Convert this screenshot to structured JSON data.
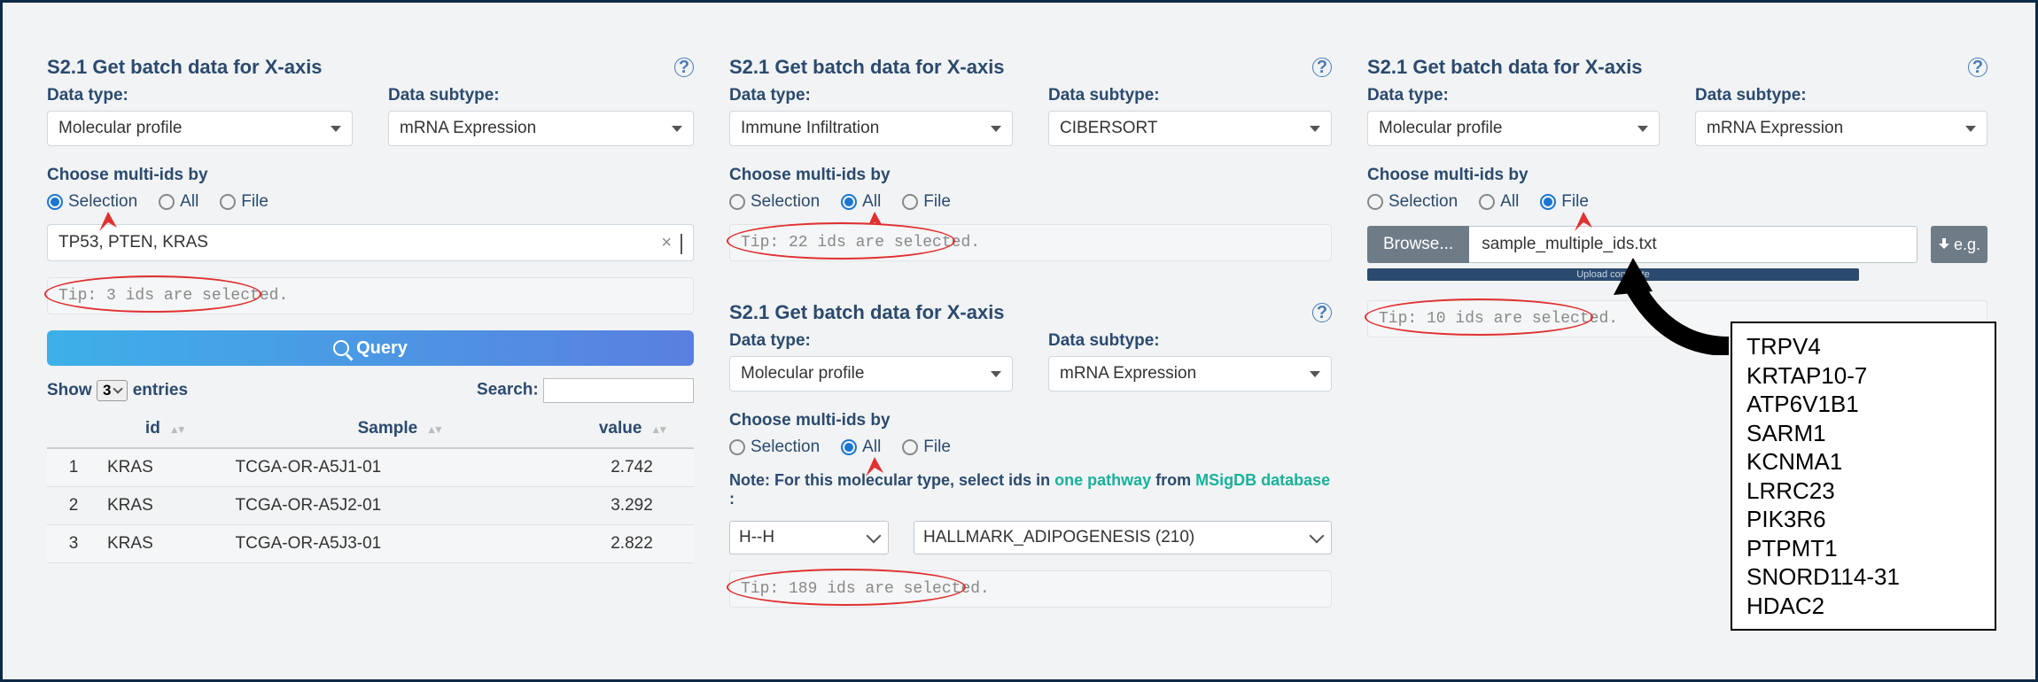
{
  "panel1": {
    "title": "S2.1 Get batch data for X-axis",
    "data_type_label": "Data type:",
    "data_type_value": "Molecular profile",
    "data_subtype_label": "Data subtype:",
    "data_subtype_value": "mRNA Expression",
    "choose_label": "Choose multi-ids by",
    "radio_selection": "Selection",
    "radio_all": "All",
    "radio_file": "File",
    "input_value": "TP53, PTEN, KRAS",
    "tip": "Tip: 3 ids are selected.",
    "query_label": "Query",
    "show_label": "Show",
    "entries_label": "entries",
    "entries_value": "3",
    "search_label": "Search:",
    "col_idx": "",
    "col_id": "id",
    "col_sample": "Sample",
    "col_value": "value",
    "rows": [
      {
        "idx": "1",
        "id": "KRAS",
        "sample": "TCGA-OR-A5J1-01",
        "value": "2.742"
      },
      {
        "idx": "2",
        "id": "KRAS",
        "sample": "TCGA-OR-A5J2-01",
        "value": "3.292"
      },
      {
        "idx": "3",
        "id": "KRAS",
        "sample": "TCGA-OR-A5J3-01",
        "value": "2.822"
      }
    ]
  },
  "panel2": {
    "title": "S2.1 Get batch data for X-axis",
    "data_type_label": "Data type:",
    "data_type_value": "Immune Infiltration",
    "data_subtype_label": "Data subtype:",
    "data_subtype_value": "CIBERSORT",
    "choose_label": "Choose multi-ids by",
    "radio_selection": "Selection",
    "radio_all": "All",
    "radio_file": "File",
    "tip": "Tip: 22 ids are selected."
  },
  "panel3": {
    "title": "S2.1 Get batch data for X-axis",
    "data_type_label": "Data type:",
    "data_type_value": "Molecular profile",
    "data_subtype_label": "Data subtype:",
    "data_subtype_value": "mRNA Expression",
    "choose_label": "Choose multi-ids by",
    "radio_selection": "Selection",
    "radio_all": "All",
    "radio_file": "File",
    "note_pre": "Note: For this molecular type, select ids in ",
    "note_link1": "one pathway",
    "note_mid": " from ",
    "note_link2": "MSigDB database",
    "note_post": " :",
    "pathway_prefix": "H--H",
    "pathway_value": "HALLMARK_ADIPOGENESIS (210)",
    "tip": "Tip: 189 ids are selected."
  },
  "panel4": {
    "title": "S2.1 Get batch data for X-axis",
    "data_type_label": "Data type:",
    "data_type_value": "Molecular profile",
    "data_subtype_label": "Data subtype:",
    "data_subtype_value": "mRNA Expression",
    "choose_label": "Choose multi-ids by",
    "radio_selection": "Selection",
    "radio_all": "All",
    "radio_file": "File",
    "browse_label": "Browse...",
    "file_name": "sample_multiple_ids.txt",
    "eg_label": "e.g.",
    "upload_status": "Upload complete",
    "tip": "Tip: 10 ids are selected.",
    "file_contents": [
      "TRPV4",
      "KRTAP10-7",
      "ATP6V1B1",
      "SARM1",
      "KCNMA1",
      "LRRC23",
      "PIK3R6",
      "PTPMT1",
      "SNORD114-31",
      "HDAC2"
    ]
  },
  "help_glyph": "?"
}
